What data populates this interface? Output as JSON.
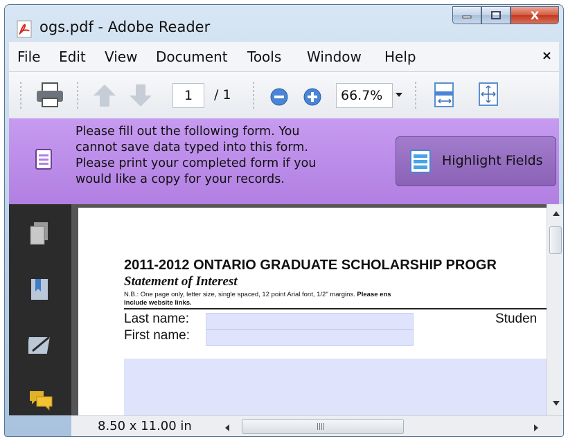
{
  "window": {
    "title": "ogs.pdf - Adobe Reader",
    "app_icon": "adobe-reader-icon",
    "controls": [
      "minimize-icon",
      "maximize-icon",
      "close-icon"
    ],
    "close_glyph": "X"
  },
  "menu": {
    "items": [
      "File",
      "Edit",
      "View",
      "Document",
      "Tools",
      "Window",
      "Help"
    ],
    "close_glyph": "×"
  },
  "toolbar": {
    "current_page": "1",
    "page_total": "/ 1",
    "zoom": "66.7%",
    "icons": [
      "print-icon",
      "previous-page-icon",
      "next-page-icon",
      "zoom-out-icon",
      "zoom-in-icon",
      "fit-width-icon",
      "fit-page-icon"
    ]
  },
  "form_bar": {
    "message": "Please fill out the following form. You\ncannot save data typed into this form.\nPlease print your completed form if you\nwould like a copy for your records.",
    "button_label": "Highlight Fields",
    "accent": "#b98ae8"
  },
  "left_panel": {
    "icons": [
      "pages-icon",
      "bookmarks-icon",
      "signatures-icon",
      "comments-icon"
    ]
  },
  "document": {
    "title": "2011-2012 ONTARIO GRADUATE SCHOLARSHIP PROGR",
    "subtitle": "Statement of Interest",
    "note_prefix": "N.B.: One page only, letter size, single spaced, 12 point Arial font, 1/2\" margins. ",
    "note_bold": "Please ens",
    "note_line2": "Include website links.",
    "last_name_label": "Last name:",
    "first_name_label": "First name:",
    "student_label": "Studen",
    "field_color": "#dfe4fc"
  },
  "status": {
    "page_size": "8.50 x 11.00 in"
  }
}
